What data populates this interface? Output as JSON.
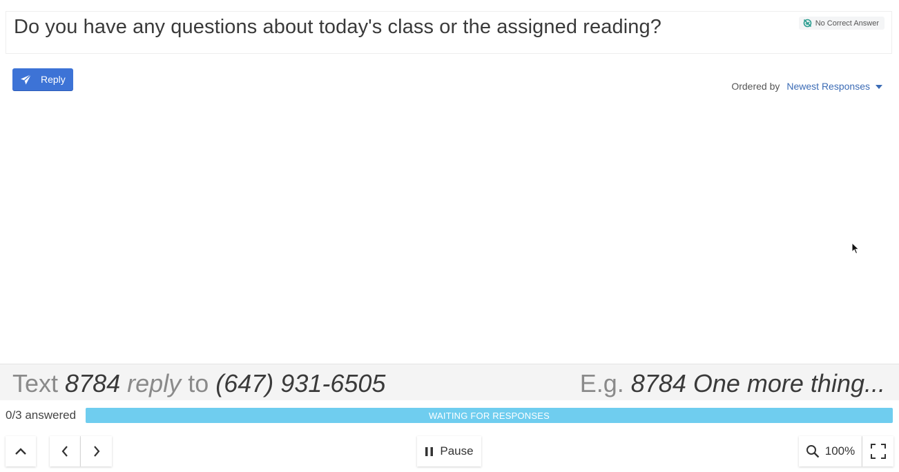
{
  "question": {
    "title": "Do you have any questions about today's class or the assigned reading?",
    "badge_label": "No Correct Answer",
    "badge_icon": "no-correct-answer-icon"
  },
  "reply_button": {
    "label": "Reply",
    "icon": "paper-plane-icon"
  },
  "ordering": {
    "label": "Ordered by",
    "value": "Newest Responses"
  },
  "instructions": {
    "left": {
      "word_text": "Text",
      "code": "8784",
      "word_reply": "reply",
      "word_to": "to",
      "phone": "(647) 931-6505"
    },
    "right": {
      "prefix": "E.g.",
      "example": "8784 One more thing..."
    }
  },
  "progress": {
    "answered_text": "0/3 answered",
    "status": "WAITING FOR RESPONSES",
    "fraction": 0
  },
  "toolbar": {
    "pause_label": "Pause",
    "zoom_label": "100%"
  },
  "colors": {
    "primary": "#3d73d6",
    "progress": "#6fcdef",
    "link": "#3b6bb5",
    "badge_icon": "#2a9d8f"
  }
}
